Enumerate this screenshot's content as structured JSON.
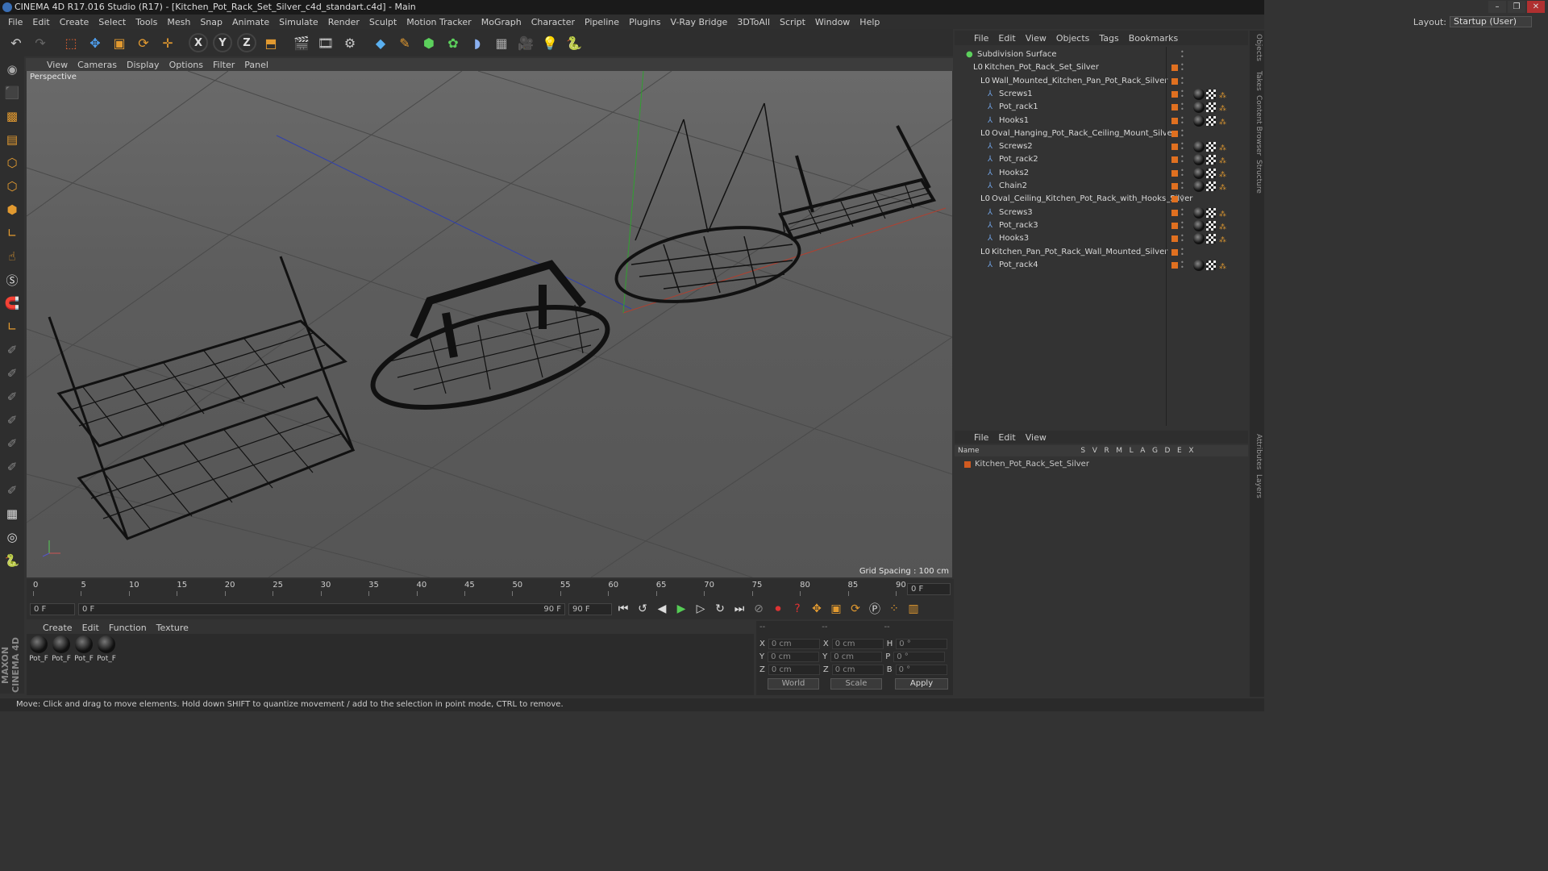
{
  "window": {
    "title": "CINEMA 4D R17.016 Studio (R17) - [Kitchen_Pot_Rack_Set_Silver_c4d_standart.c4d] - Main",
    "controls": [
      "–",
      "❐",
      "✕"
    ]
  },
  "menu": [
    "File",
    "Edit",
    "Create",
    "Select",
    "Tools",
    "Mesh",
    "Snap",
    "Animate",
    "Simulate",
    "Render",
    "Sculpt",
    "Motion Tracker",
    "MoGraph",
    "Character",
    "Pipeline",
    "Plugins",
    "V-Ray Bridge",
    "3DToAll",
    "Script",
    "Window",
    "Help"
  ],
  "layout": {
    "label": "Layout:",
    "value": "Startup (User)"
  },
  "toolbar_icons": [
    "undo-icon",
    "redo-icon",
    "select-icon",
    "move-icon",
    "scale-icon",
    "rotate-icon",
    "move-plus-icon"
  ],
  "axis_locks": [
    "X",
    "Y",
    "Z"
  ],
  "viewport": {
    "menu": [
      "View",
      "Cameras",
      "Display",
      "Options",
      "Filter",
      "Panel"
    ],
    "label": "Perspective",
    "grid_spacing": "Grid Spacing : 100 cm"
  },
  "timeline": {
    "ticks": [
      "0",
      "5",
      "10",
      "15",
      "20",
      "25",
      "30",
      "35",
      "40",
      "45",
      "50",
      "55",
      "60",
      "65",
      "70",
      "75",
      "80",
      "85",
      "90"
    ],
    "current_frame": "0 F",
    "start": "0 F",
    "range_start": "0 F",
    "range_end": "90 F",
    "end": "90 F"
  },
  "materials": {
    "menu": [
      "Create",
      "Edit",
      "Function",
      "Texture"
    ],
    "items": [
      "Pot_F",
      "Pot_F",
      "Pot_F",
      "Pot_F"
    ]
  },
  "coords": {
    "header": [
      "--",
      "--",
      "--"
    ],
    "rows": [
      {
        "a": "X",
        "av": "0 cm",
        "b": "X",
        "bv": "0 cm",
        "c": "H",
        "cv": "0 °"
      },
      {
        "a": "Y",
        "av": "0 cm",
        "b": "Y",
        "bv": "0 cm",
        "c": "P",
        "cv": "0 °"
      },
      {
        "a": "Z",
        "av": "0 cm",
        "b": "Z",
        "bv": "0 cm",
        "c": "B",
        "cv": "0 °"
      }
    ],
    "world": "World",
    "scale": "Scale",
    "apply": "Apply"
  },
  "objects_panel": {
    "menu": [
      "File",
      "Edit",
      "View",
      "Objects",
      "Tags",
      "Bookmarks"
    ],
    "rows": [
      {
        "name": "Subdivision Surface",
        "level": 0,
        "kind": "subdiv",
        "tags": ""
      },
      {
        "name": "Kitchen_Pot_Rack_Set_Silver",
        "level": 1,
        "kind": "null",
        "tags": ""
      },
      {
        "name": "Wall_Mounted_Kitchen_Pan_Pot_Rack_Silver",
        "level": 2,
        "kind": "null",
        "tags": ""
      },
      {
        "name": "Screws1",
        "level": 3,
        "kind": "mesh",
        "tags": "full"
      },
      {
        "name": "Pot_rack1",
        "level": 3,
        "kind": "mesh",
        "tags": "full"
      },
      {
        "name": "Hooks1",
        "level": 3,
        "kind": "mesh",
        "tags": "full"
      },
      {
        "name": "Oval_Hanging_Pot_Rack_Ceiling_Mount_Silver",
        "level": 2,
        "kind": "null",
        "tags": ""
      },
      {
        "name": "Screws2",
        "level": 3,
        "kind": "mesh",
        "tags": "full"
      },
      {
        "name": "Pot_rack2",
        "level": 3,
        "kind": "mesh",
        "tags": "full"
      },
      {
        "name": "Hooks2",
        "level": 3,
        "kind": "mesh",
        "tags": "full"
      },
      {
        "name": "Chain2",
        "level": 3,
        "kind": "mesh",
        "tags": "full"
      },
      {
        "name": "Oval_Ceiling_Kitchen_Pot_Rack_with_Hooks_Silver",
        "level": 2,
        "kind": "null",
        "tags": ""
      },
      {
        "name": "Screws3",
        "level": 3,
        "kind": "mesh",
        "tags": "full"
      },
      {
        "name": "Pot_rack3",
        "level": 3,
        "kind": "mesh",
        "tags": "full"
      },
      {
        "name": "Hooks3",
        "level": 3,
        "kind": "mesh",
        "tags": "full"
      },
      {
        "name": "Kitchen_Pan_Pot_Rack_Wall_Mounted_Silver",
        "level": 2,
        "kind": "null",
        "tags": ""
      },
      {
        "name": "Pot_rack4",
        "level": 3,
        "kind": "mesh",
        "tags": "full"
      }
    ]
  },
  "layers_panel": {
    "menu": [
      "File",
      "Edit",
      "View"
    ],
    "columns": "Name                                            S   V   R   M   L   A   G   D   E   X",
    "layer": "Kitchen_Pot_Rack_Set_Silver"
  },
  "right_tabs": [
    "Objects",
    "Takes",
    "Content Browser",
    "Structure",
    "Attributes",
    "Layers"
  ],
  "status": "Move: Click and drag to move elements. Hold down SHIFT to quantize movement / add to the selection in point mode, CTRL to remove.",
  "brand": "MAXON CINEMA 4D",
  "colors": {
    "accent": "#e29a30",
    "tag": "#e07020",
    "layer": "#d05a20"
  }
}
